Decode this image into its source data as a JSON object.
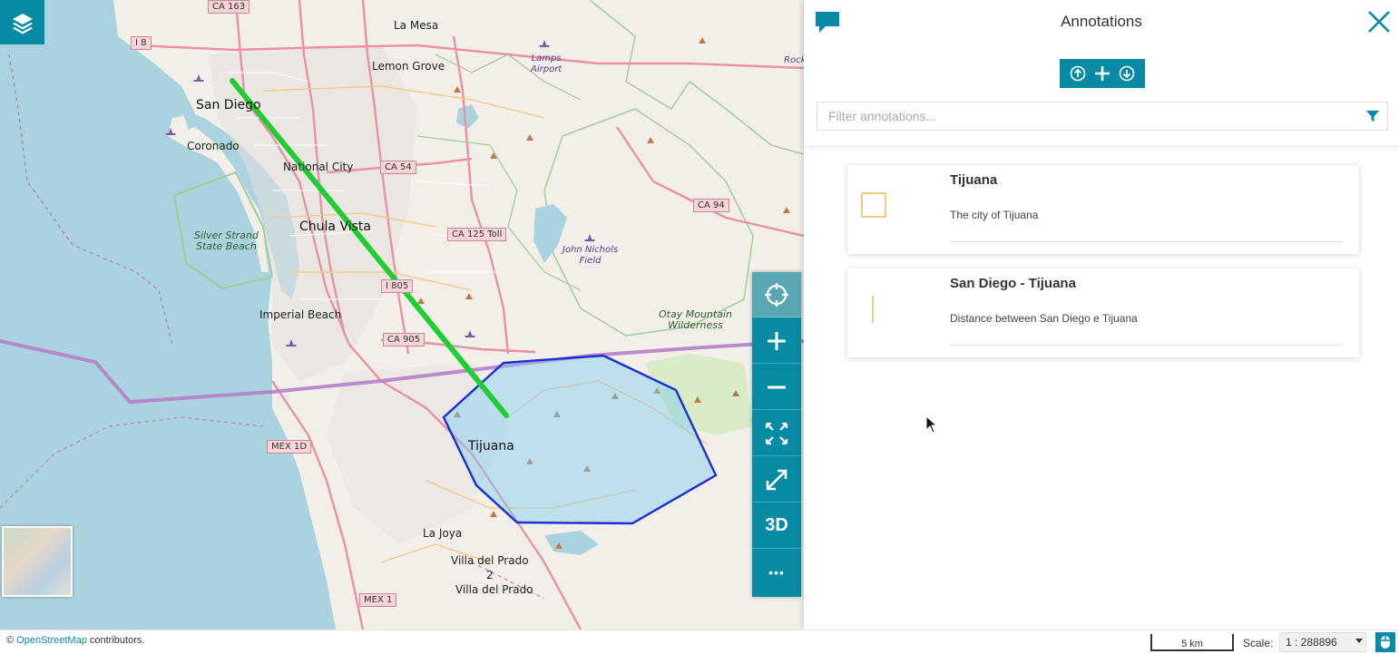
{
  "panel": {
    "title": "Annotations",
    "filter_placeholder": "Filter annotations...",
    "actions": [
      "upload-icon",
      "plus-icon",
      "download-icon"
    ],
    "annotations": [
      {
        "title": "Tijuana",
        "description": "The city of Tijuana",
        "symbol": "polygon-icon",
        "color": "#f0c060"
      },
      {
        "title": "San Diego - Tijuana",
        "description": "Distance between San Diego e Tijuana",
        "symbol": "line-icon",
        "color": "#e6c25a"
      }
    ]
  },
  "toolbar": {
    "buttons": [
      "locate-icon",
      "zoom-in-icon",
      "zoom-out-icon",
      "zoom-to-max-extent-icon",
      "fullscreen-icon",
      "3D",
      "more-icon"
    ],
    "three_d_label": "3D",
    "more_label": "•••"
  },
  "map": {
    "labels": {
      "san_diego": "San Diego",
      "coronado": "Coronado",
      "national_city": "National City",
      "chula_vista": "Chula Vista",
      "imperial_beach": "Imperial Beach",
      "tijuana": "Tijuana",
      "la_mesa": "La Mesa",
      "lemon_grove": "Lemon Grove",
      "la_joya": "La Joya",
      "villa_del_prado": "Villa del Prado",
      "villa_del_prado_2": "Villa del Prado\n2",
      "silver_strand": "Silver Strand\nState Beach",
      "otay_mountain": "Otay Mountain\nWilderness",
      "john_nichols": "John Nichols\nField",
      "lamps_airport": "Lamps\nAirport",
      "rock": "Rock"
    },
    "shields": {
      "ca163": "CA 163",
      "i8": "I 8",
      "ca54": "CA 54",
      "ca125": "CA 125 Toll",
      "ca94": "CA 94",
      "i805": "I 805",
      "ca905": "CA 905",
      "mex1d": "MEX 1D",
      "mex1": "MEX 1"
    },
    "annotation_colors": {
      "line": "#22cc33",
      "polygon_stroke": "#1a2fd6",
      "polygon_fill": "#7ecbf0",
      "border": "#b67fc8"
    }
  },
  "footer": {
    "attribution_prefix": "© ",
    "attribution_link": "OpenStreetMap",
    "attribution_suffix": " contributors.",
    "scalebar_label": "5 km",
    "scale_label": "Scale:",
    "scale_value": "1 : 288896"
  },
  "colors": {
    "accent": "#078aa3"
  }
}
